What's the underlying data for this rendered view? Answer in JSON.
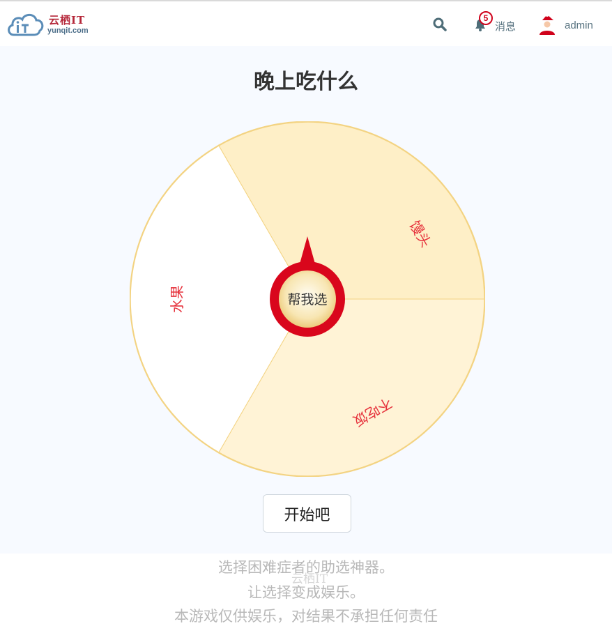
{
  "header": {
    "logo": {
      "name_cn": "云栖IT",
      "domain": "yunqit.com"
    },
    "message": {
      "label": "消息",
      "badge_count": "5"
    },
    "user": {
      "name": "admin"
    }
  },
  "main": {
    "title": "晚上吃什么",
    "wheel": {
      "segments": [
        {
          "label": "馒头",
          "color": "#feefc7"
        },
        {
          "label": "不吃饭",
          "color": "#fff3d6"
        },
        {
          "label": "水果",
          "color": "#ffffff"
        }
      ],
      "center_label": "帮我选",
      "pointer_color": "#d9061c",
      "text_color": "#e6333d"
    },
    "start_label": "开始吧"
  },
  "footer": {
    "lines": [
      "选择困难症者的助选神器。",
      "让选择变成娱乐。",
      "本游戏仅供娱乐，对结果不承担任何责任"
    ],
    "watermark": "云栖IT"
  }
}
